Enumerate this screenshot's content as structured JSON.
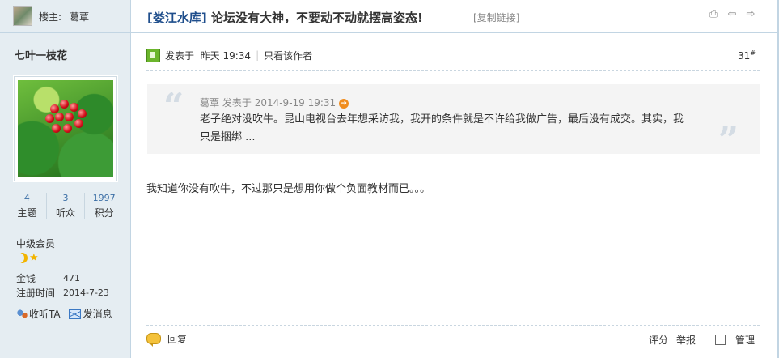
{
  "sidebar": {
    "op_label": "楼主:",
    "op_name": "葛覃",
    "username": "七叶一枝花",
    "stats": [
      {
        "value": "4",
        "label": "主题"
      },
      {
        "value": "3",
        "label": "听众"
      },
      {
        "value": "1997",
        "label": "积分"
      }
    ],
    "rank": "中级会员",
    "rank_icons": [
      "moon-icon",
      "star-icon"
    ],
    "money_label": "金钱",
    "money_value": "471",
    "register_label": "注册时间",
    "register_value": "2014-7-23",
    "follow_label": "收听TA",
    "message_label": "发消息"
  },
  "thread": {
    "category": "[娄江水库]",
    "title": "论坛没有大神，不要动不动就摆高姿态!",
    "copy_link": "[复制链接]",
    "toolbar_icons": [
      "print-icon",
      "prev-icon",
      "next-icon"
    ]
  },
  "post": {
    "posted_label": "发表于",
    "posted_time": "昨天 19:34",
    "only_author": "只看该作者",
    "floor": "31",
    "floor_sup": "#",
    "quote": {
      "author": "葛覃",
      "posted_label": "发表于",
      "time": "2014-9-19 19:31",
      "text": "老子绝对没吹牛。昆山电视台去年想采访我，我开的条件就是不许给我做广告，最后没有成交。其实，我只是捆绑 ..."
    },
    "body": "我知道你没有吹牛，不过那只是想用你做个负面教材而已。。。",
    "reply_label": "回复",
    "rate_label": "评分",
    "report_label": "举报",
    "manage_label": "管理"
  }
}
